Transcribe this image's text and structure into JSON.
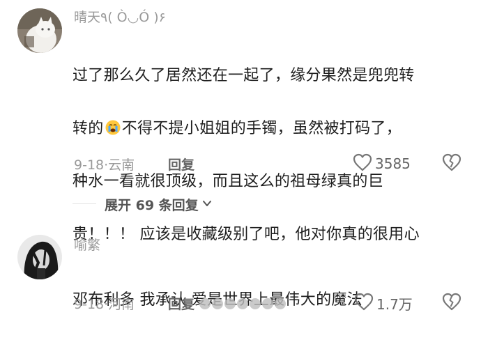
{
  "comments": [
    {
      "username": "晴天٩( Ò◡Ó )۶",
      "text_lines": [
        "过了那么久了居然还在一起了，缘分果然是兜兜转",
        "转的",
        "不得不提小姐姐的手镯，虽然被打码了，",
        "种水一看就很顶级，而且这么的祖母绿真的巨",
        "贵！！！ 应该是收藏级别了吧，他对你真的很用心"
      ],
      "emoji": "crying-face",
      "date": "9-18",
      "location": "云南",
      "reply_label": "回复",
      "like_count": "3585"
    },
    {
      "username": "喻繁",
      "text_lines": [
        "邓布利多 我承认 爱是世界上最伟大的魔法"
      ],
      "date": "9-18",
      "location": "河南",
      "reply_label": "回复",
      "like_count": "1.7万"
    }
  ],
  "separator": "·",
  "expand": {
    "label": "展开 69 条回复"
  },
  "colors": {
    "meta": "#9a9a9a",
    "text": "#1e1e1e",
    "icon": "#777777"
  }
}
